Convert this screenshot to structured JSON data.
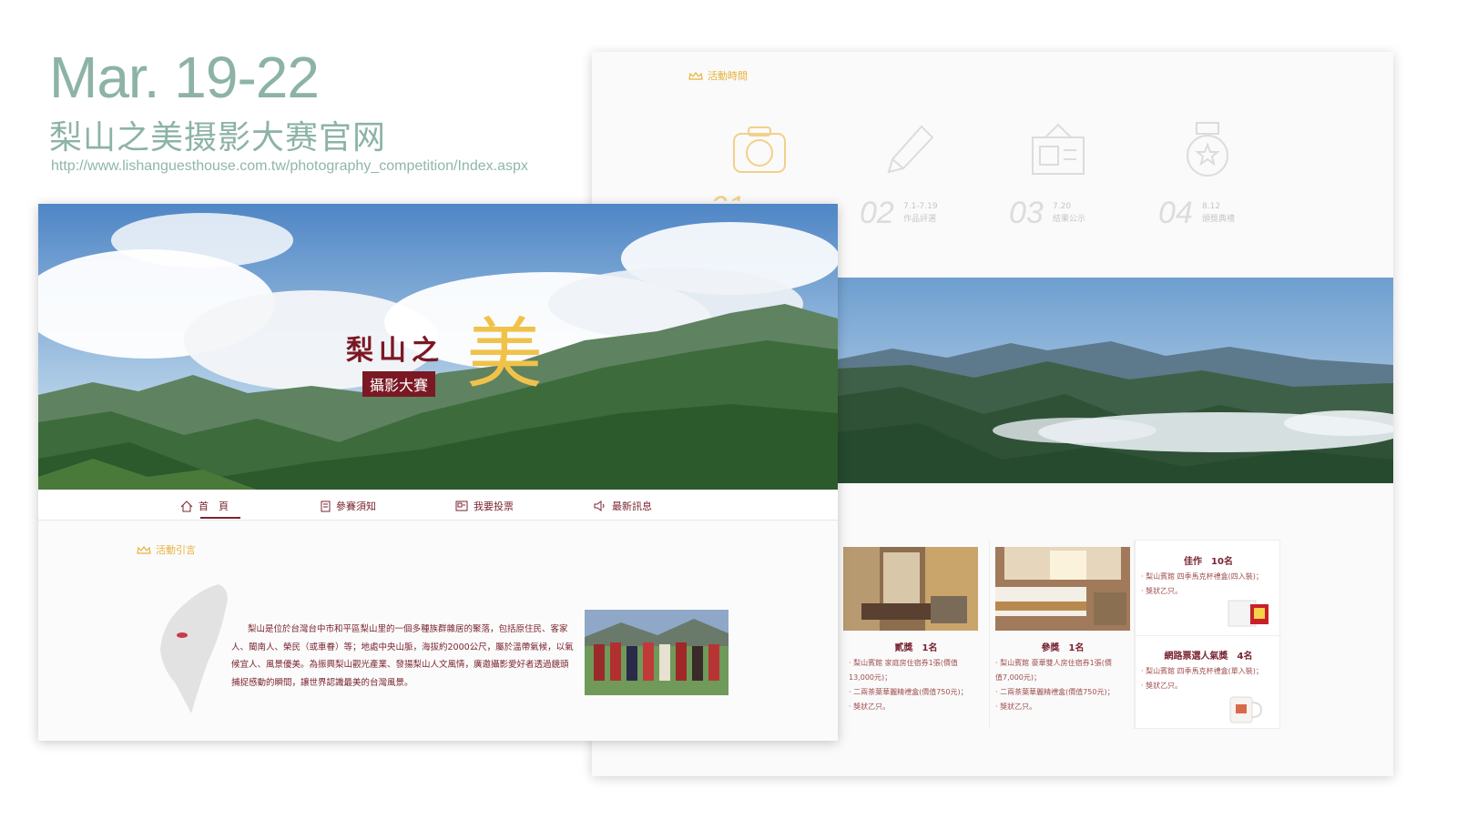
{
  "header": {
    "date": "Mar. 19-22",
    "title": "梨山之美摄影大赛官网",
    "url": "http://www.lishanguesthouse.com.tw/photography_competition/Index.aspx"
  },
  "back_card": {
    "section_label": "活動時間",
    "timeline": [
      {
        "num": "01",
        "date": "",
        "label": "",
        "icon": "camera-icon"
      },
      {
        "num": "02",
        "date": "7.1-7.19",
        "label": "作品評選",
        "icon": "pencil-icon"
      },
      {
        "num": "03",
        "date": "7.20",
        "label": "結果公示",
        "icon": "picture-board-icon"
      },
      {
        "num": "04",
        "date": "8.12",
        "label": "頒獎典禮",
        "icon": "medal-icon"
      }
    ],
    "prizes": [
      {
        "title": "貳獎　1名",
        "lines": [
          "· 梨山賓館 家庭房住宿券1張(價值",
          "  13,000元)；",
          "· 二兩茶葉華麗精禮盒(價值750元)；",
          "· 獎狀乙只。"
        ]
      },
      {
        "title": "參獎　1名",
        "lines": [
          "· 梨山賓館 豪華雙人房住宿券1張(價",
          "  值7,000元)；",
          "· 二兩茶葉華麗精禮盒(價值750元)；",
          "· 獎狀乙只。"
        ]
      },
      {
        "title": "佳作　10名",
        "lines": [
          "· 梨山賓館 四季馬克杯禮盒(四入裝)；",
          "· 獎狀乙只。"
        ]
      },
      {
        "title": "網路票選人氣獎　4名",
        "lines": [
          "· 梨山賓館 四季馬克杯禮盒(單入裝)；",
          "· 獎狀乙只。"
        ]
      }
    ]
  },
  "front_card": {
    "logo": {
      "main": "梨山之",
      "big": "美",
      "badge": "攝影大賽"
    },
    "nav": [
      {
        "label": "首　頁",
        "icon": "home-icon"
      },
      {
        "label": "參賽須知",
        "icon": "document-icon"
      },
      {
        "label": "我要投票",
        "icon": "vote-icon"
      },
      {
        "label": "最新訊息",
        "icon": "speaker-icon"
      }
    ],
    "intro_label": "活動引言",
    "intro_text": "梨山是位於台灣台中市和平區梨山里的一個多種族群雜居的聚落，包括原住民、客家人、閩南人、榮民（或車眷）等；地處中央山脈，海拔約2000公尺，屬於溫帶氣候，以氣候宜人、風景優美。為振興梨山觀光產業、發揚梨山人文風情，廣邀攝影愛好者透過鏡頭捕捉感動的瞬間，讓世界認識最美的台灣風景。"
  }
}
